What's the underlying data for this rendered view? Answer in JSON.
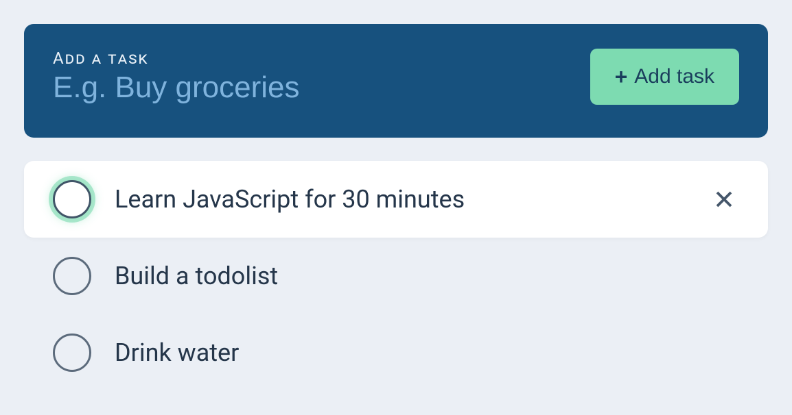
{
  "input": {
    "label": "Add a task",
    "placeholder": "E.g. Buy groceries",
    "value": ""
  },
  "add_button": {
    "label": "Add task",
    "icon": "+"
  },
  "tasks": [
    {
      "text": "Learn JavaScript for 30 minutes",
      "active": true
    },
    {
      "text": "Build a todolist",
      "active": false
    },
    {
      "text": "Drink water",
      "active": false
    }
  ]
}
